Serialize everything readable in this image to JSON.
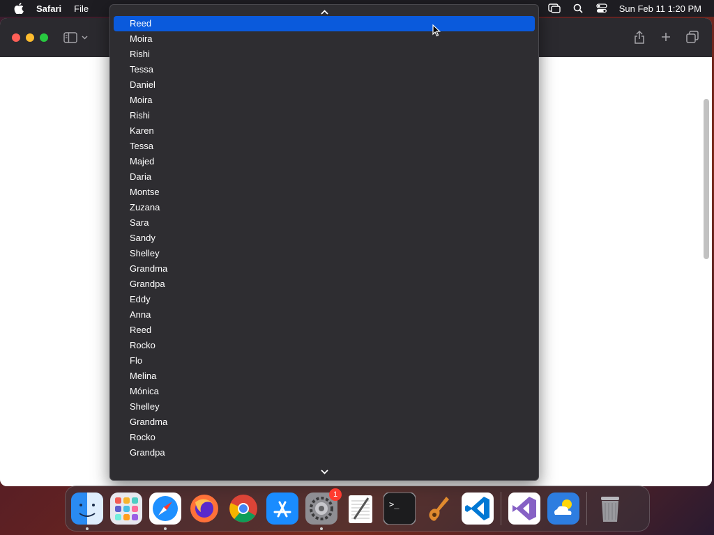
{
  "menubar": {
    "app_name": "Safari",
    "items": [
      "File"
    ],
    "clock": "Sun Feb 11  1:20 PM"
  },
  "dropdown": {
    "options": [
      "Reed",
      "Moira",
      "Rishi",
      "Tessa",
      "Daniel",
      "Moira",
      "Rishi",
      "Karen",
      "Tessa",
      "Majed",
      "Daria",
      "Montse",
      "Zuzana",
      "Sara",
      "Sandy",
      "Shelley",
      "Grandma",
      "Grandpa",
      "Eddy",
      "Anna",
      "Reed",
      "Rocko",
      "Flo",
      "Melina",
      "Mónica",
      "Shelley",
      "Grandma",
      "Rocko",
      "Grandpa"
    ],
    "selected_index": 0
  },
  "dock": {
    "apps": [
      {
        "name": "finder-icon",
        "running": true
      },
      {
        "name": "launchpad-icon",
        "running": false
      },
      {
        "name": "safari-icon",
        "running": true
      },
      {
        "name": "firefox-icon",
        "running": false
      },
      {
        "name": "chrome-icon",
        "running": false
      },
      {
        "name": "app-store-icon",
        "running": false
      },
      {
        "name": "system-settings-icon",
        "running": true,
        "badge": "1"
      },
      {
        "name": "textedit-icon",
        "running": false
      },
      {
        "name": "terminal-icon",
        "running": false
      },
      {
        "name": "garageband-icon",
        "running": false
      },
      {
        "name": "vscode-icon",
        "running": false
      },
      {
        "name": "visual-studio-icon",
        "running": false
      },
      {
        "name": "weather-icon",
        "running": false
      },
      {
        "name": "trash-icon",
        "running": false
      }
    ]
  },
  "colors": {
    "selection": "#0a5adc",
    "menu_bg": "#2e2d31",
    "toolbar_bg": "#2b2a2f"
  }
}
